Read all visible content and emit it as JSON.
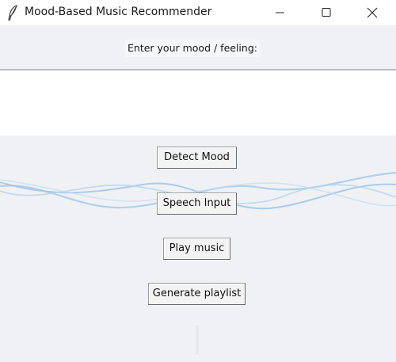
{
  "window": {
    "title": "Mood-Based Music Recommender",
    "icon": "feather-icon",
    "controls": [
      "minimize-icon",
      "maximize-icon",
      "close-icon"
    ]
  },
  "mood_prompt": {
    "label": "Enter your mood / feeling:",
    "value": ""
  },
  "buttons": {
    "detect_mood": "Detect Mood",
    "speech_input": "Speech Input",
    "play_music": "Play music",
    "generate_playlist": "Generate playlist"
  },
  "colors": {
    "window_bg": "#eff1f4",
    "titlebar_bg": "#ffffff",
    "input_bg": "#ffffff",
    "wave": "#9ec6e8"
  }
}
